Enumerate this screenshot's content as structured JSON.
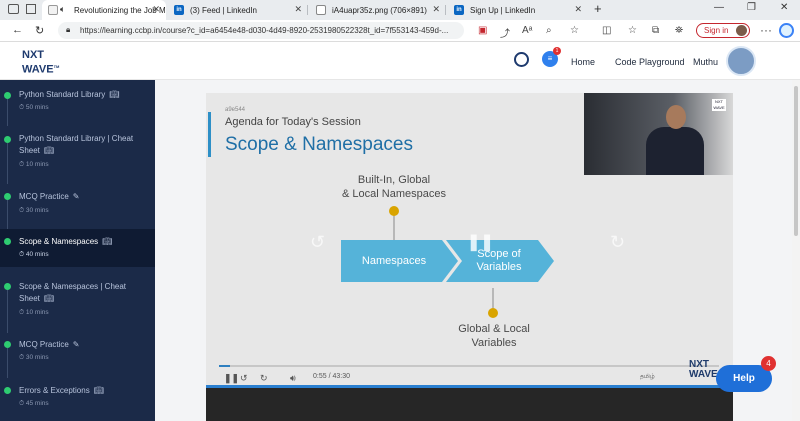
{
  "browser": {
    "tabs": [
      {
        "title": "Revolutionizing the Job Ma",
        "active": true,
        "icon": "page-icon"
      },
      {
        "title": "(3) Feed | LinkedIn",
        "active": false,
        "icon": "linkedin-icon"
      },
      {
        "title": "iA4uapr35z.png (706×891)",
        "active": false,
        "icon": "image-icon"
      },
      {
        "title": "Sign Up | LinkedIn",
        "active": false,
        "icon": "linkedin-icon"
      }
    ],
    "new_tab": "+",
    "url": "https://learning.ccbp.in/course?c_id=a6454e48-d030-4d49-8920-2531980522328t_id=7f553143-459d-...",
    "signin_label": "Sign in",
    "colors": {
      "signin": "#c4262e",
      "tabbar": "#e9ecef"
    }
  },
  "header": {
    "logo_line1": "NXT",
    "logo_line2": "WAVE",
    "logo_tm": "TM",
    "notification_count": "1",
    "nav": [
      "Home",
      "Code Playground"
    ],
    "user_name": "Muthu"
  },
  "sidebar": {
    "items": [
      {
        "title": "Python Standard Library",
        "duration": "50 mins",
        "icon": "book-icon",
        "active": false
      },
      {
        "title": "Python Standard Library | Cheat Sheet",
        "duration": "10 mins",
        "icon": "book-icon",
        "active": false
      },
      {
        "title": "MCQ Practice",
        "duration": "30 mins",
        "icon": "pencil-icon",
        "active": false
      },
      {
        "title": "Scope & Namespaces",
        "duration": "40 mins",
        "icon": "book-icon",
        "active": true
      },
      {
        "title": "Scope & Namespaces | Cheat Sheet",
        "duration": "10 mins",
        "icon": "book-icon",
        "active": false
      },
      {
        "title": "MCQ Practice",
        "duration": "30 mins",
        "icon": "pencil-icon",
        "active": false
      },
      {
        "title": "Errors & Exceptions",
        "duration": "45 mins",
        "icon": "book-icon",
        "active": false
      }
    ],
    "colors": {
      "bg": "#1b2a48",
      "active_bg": "#0f1b33",
      "done": "#2ecc71"
    }
  },
  "video": {
    "slide_id": "a9e544",
    "agenda": "Agenda for Today's Session",
    "heading": "Scope & Namespaces",
    "diagram": {
      "top_label": [
        "Built-In, Global",
        "& Local Namespaces"
      ],
      "left_box": "Namespaces",
      "right_box": [
        "Scope of",
        "Variables"
      ],
      "bottom_label": [
        "Global & Local",
        "Variables"
      ]
    },
    "presenter_badge": "NXT WAVE",
    "current_time": "0:55",
    "time_separator": "/",
    "total_time": "43:30",
    "progress": 0.021,
    "language": "தமிழ்",
    "watermark": [
      "NXT",
      "WAVE"
    ],
    "colors": {
      "heading": "#1f6fa6",
      "arrow": "#55b3d9",
      "dot": "#d9a400",
      "progress": "#2f80c0"
    }
  },
  "help": {
    "label": "Help",
    "count": "4",
    "colors": {
      "button": "#1f6fd8",
      "badge": "#e03131"
    }
  }
}
